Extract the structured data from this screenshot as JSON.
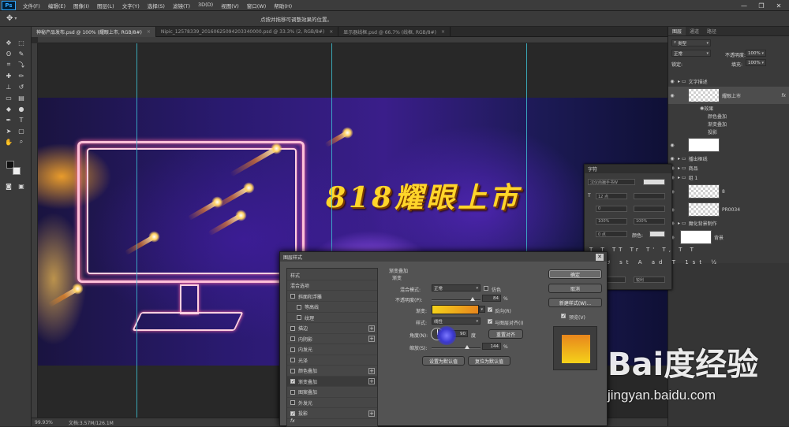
{
  "app": {
    "logo": "Ps"
  },
  "menu": [
    "文件(F)",
    "编辑(E)",
    "图像(I)",
    "图层(L)",
    "文字(Y)",
    "选择(S)",
    "滤镜(T)",
    "3D(D)",
    "视图(V)",
    "窗口(W)",
    "帮助(H)"
  ],
  "window_controls": [
    "—",
    "❐",
    "✕"
  ],
  "options_hint": "点按并拖移可调整效果的位置。",
  "tabs": [
    {
      "label": "神秘产品发布.psd @ 100% (耀眼上市, RGB/8#)",
      "close": "×",
      "active": true
    },
    {
      "label": "Nipic_12578339_20160625094203340000.psd @ 33.3% (2, RGB/8#)",
      "close": "×",
      "active": false
    },
    {
      "label": "显示器线框.psd @ 66.7% (线框, RGB/8#)",
      "close": "×",
      "active": false
    }
  ],
  "canvas": {
    "headline": "818耀眼上市"
  },
  "status": {
    "zoom": "99.93%",
    "doc": "文档:3.57M/126.1M"
  },
  "layers_panel": {
    "tabs": [
      "图层",
      "通道",
      "路径"
    ],
    "kind_filter": "类型",
    "blend_mode": "正常",
    "opacity_label": "不透明度:",
    "opacity": "100%",
    "lock_label": "锁定:",
    "fill_label": "填充:",
    "fill": "100%",
    "rows": [
      {
        "indent": 0,
        "label": "文字描述",
        "kind": "group"
      },
      {
        "indent": 1,
        "label": "耀眼上市",
        "kind": "text",
        "fx": "fx"
      },
      {
        "indent": 2,
        "label": "效果",
        "kind": "effect"
      },
      {
        "indent": 3,
        "label": "颜色叠加",
        "kind": "effect"
      },
      {
        "indent": 3,
        "label": "渐变叠加",
        "kind": "effect"
      },
      {
        "indent": 3,
        "label": "投影",
        "kind": "effect"
      },
      {
        "indent": 1,
        "label": "",
        "kind": "mask"
      },
      {
        "indent": 0,
        "label": "播出框线",
        "kind": "group"
      },
      {
        "indent": 0,
        "label": "商品",
        "kind": "group"
      },
      {
        "indent": 0,
        "label": "组 1",
        "kind": "group"
      },
      {
        "indent": 1,
        "label": "8",
        "kind": "layer"
      },
      {
        "indent": 1,
        "label": "PR0034",
        "kind": "layer"
      },
      {
        "indent": 0,
        "label": "魔化背景制作",
        "kind": "group"
      },
      {
        "indent": 0,
        "label": "背景",
        "kind": "bg"
      }
    ]
  },
  "char_panel": {
    "title": "字符",
    "font": "汉仪尚巍手书W",
    "size": "12 点",
    "tracking": "0",
    "scale": "100%",
    "baseline": "0 点",
    "color_label": "颜色:",
    "lang": "美国英语",
    "aa": "锐利"
  },
  "dialog": {
    "title": "图层样式",
    "close": "✕",
    "styles_header": "样式",
    "blend_options": "混合选项",
    "style_items": [
      {
        "label": "斜面和浮雕",
        "checked": false,
        "plus": false,
        "indent": false
      },
      {
        "label": "等高线",
        "checked": false,
        "plus": false,
        "indent": true
      },
      {
        "label": "纹理",
        "checked": false,
        "plus": false,
        "indent": true
      },
      {
        "label": "描边",
        "checked": false,
        "plus": true,
        "indent": false
      },
      {
        "label": "内阴影",
        "checked": false,
        "plus": true,
        "indent": false
      },
      {
        "label": "内发光",
        "checked": false,
        "plus": false,
        "indent": false
      },
      {
        "label": "光泽",
        "checked": false,
        "plus": false,
        "indent": false
      },
      {
        "label": "颜色叠加",
        "checked": false,
        "plus": true,
        "indent": false
      },
      {
        "label": "渐变叠加",
        "checked": true,
        "plus": true,
        "indent": false,
        "selected": true
      },
      {
        "label": "图案叠加",
        "checked": false,
        "plus": false,
        "indent": false
      },
      {
        "label": "外发光",
        "checked": false,
        "plus": false,
        "indent": false
      },
      {
        "label": "投影",
        "checked": true,
        "plus": true,
        "indent": false
      }
    ],
    "section_title": "渐变叠加",
    "sub_title": "渐变",
    "blend_mode_label": "混合模式:",
    "blend_mode": "正常",
    "dither_label": "仿色",
    "opacity_label": "不透明度(P):",
    "opacity_value": "84",
    "opacity_fraction": 0.84,
    "percent": "%",
    "gradient_label": "渐变:",
    "gradient_colors": [
      "#f5d21a",
      "#e8861c"
    ],
    "reverse_label": "反向(R)",
    "style_label": "样式:",
    "style_value": "线性",
    "align_label": "与图层对齐(I)",
    "angle_label": "角度(N):",
    "angle_value": "90",
    "degree": "度",
    "reset_align": "重置对齐",
    "scale_label": "缩放(S):",
    "scale_value": "144",
    "scale_fraction": 0.72,
    "make_default": "设置为默认值",
    "reset_default": "复位为默认值",
    "ok": "确定",
    "cancel": "取消",
    "new_style": "新建样式(W)...",
    "preview_label": "预览(V)",
    "fx_icon_label": "fx"
  },
  "watermark": {
    "logo": "Bai度经验",
    "url": "jingyan.baidu.com"
  }
}
